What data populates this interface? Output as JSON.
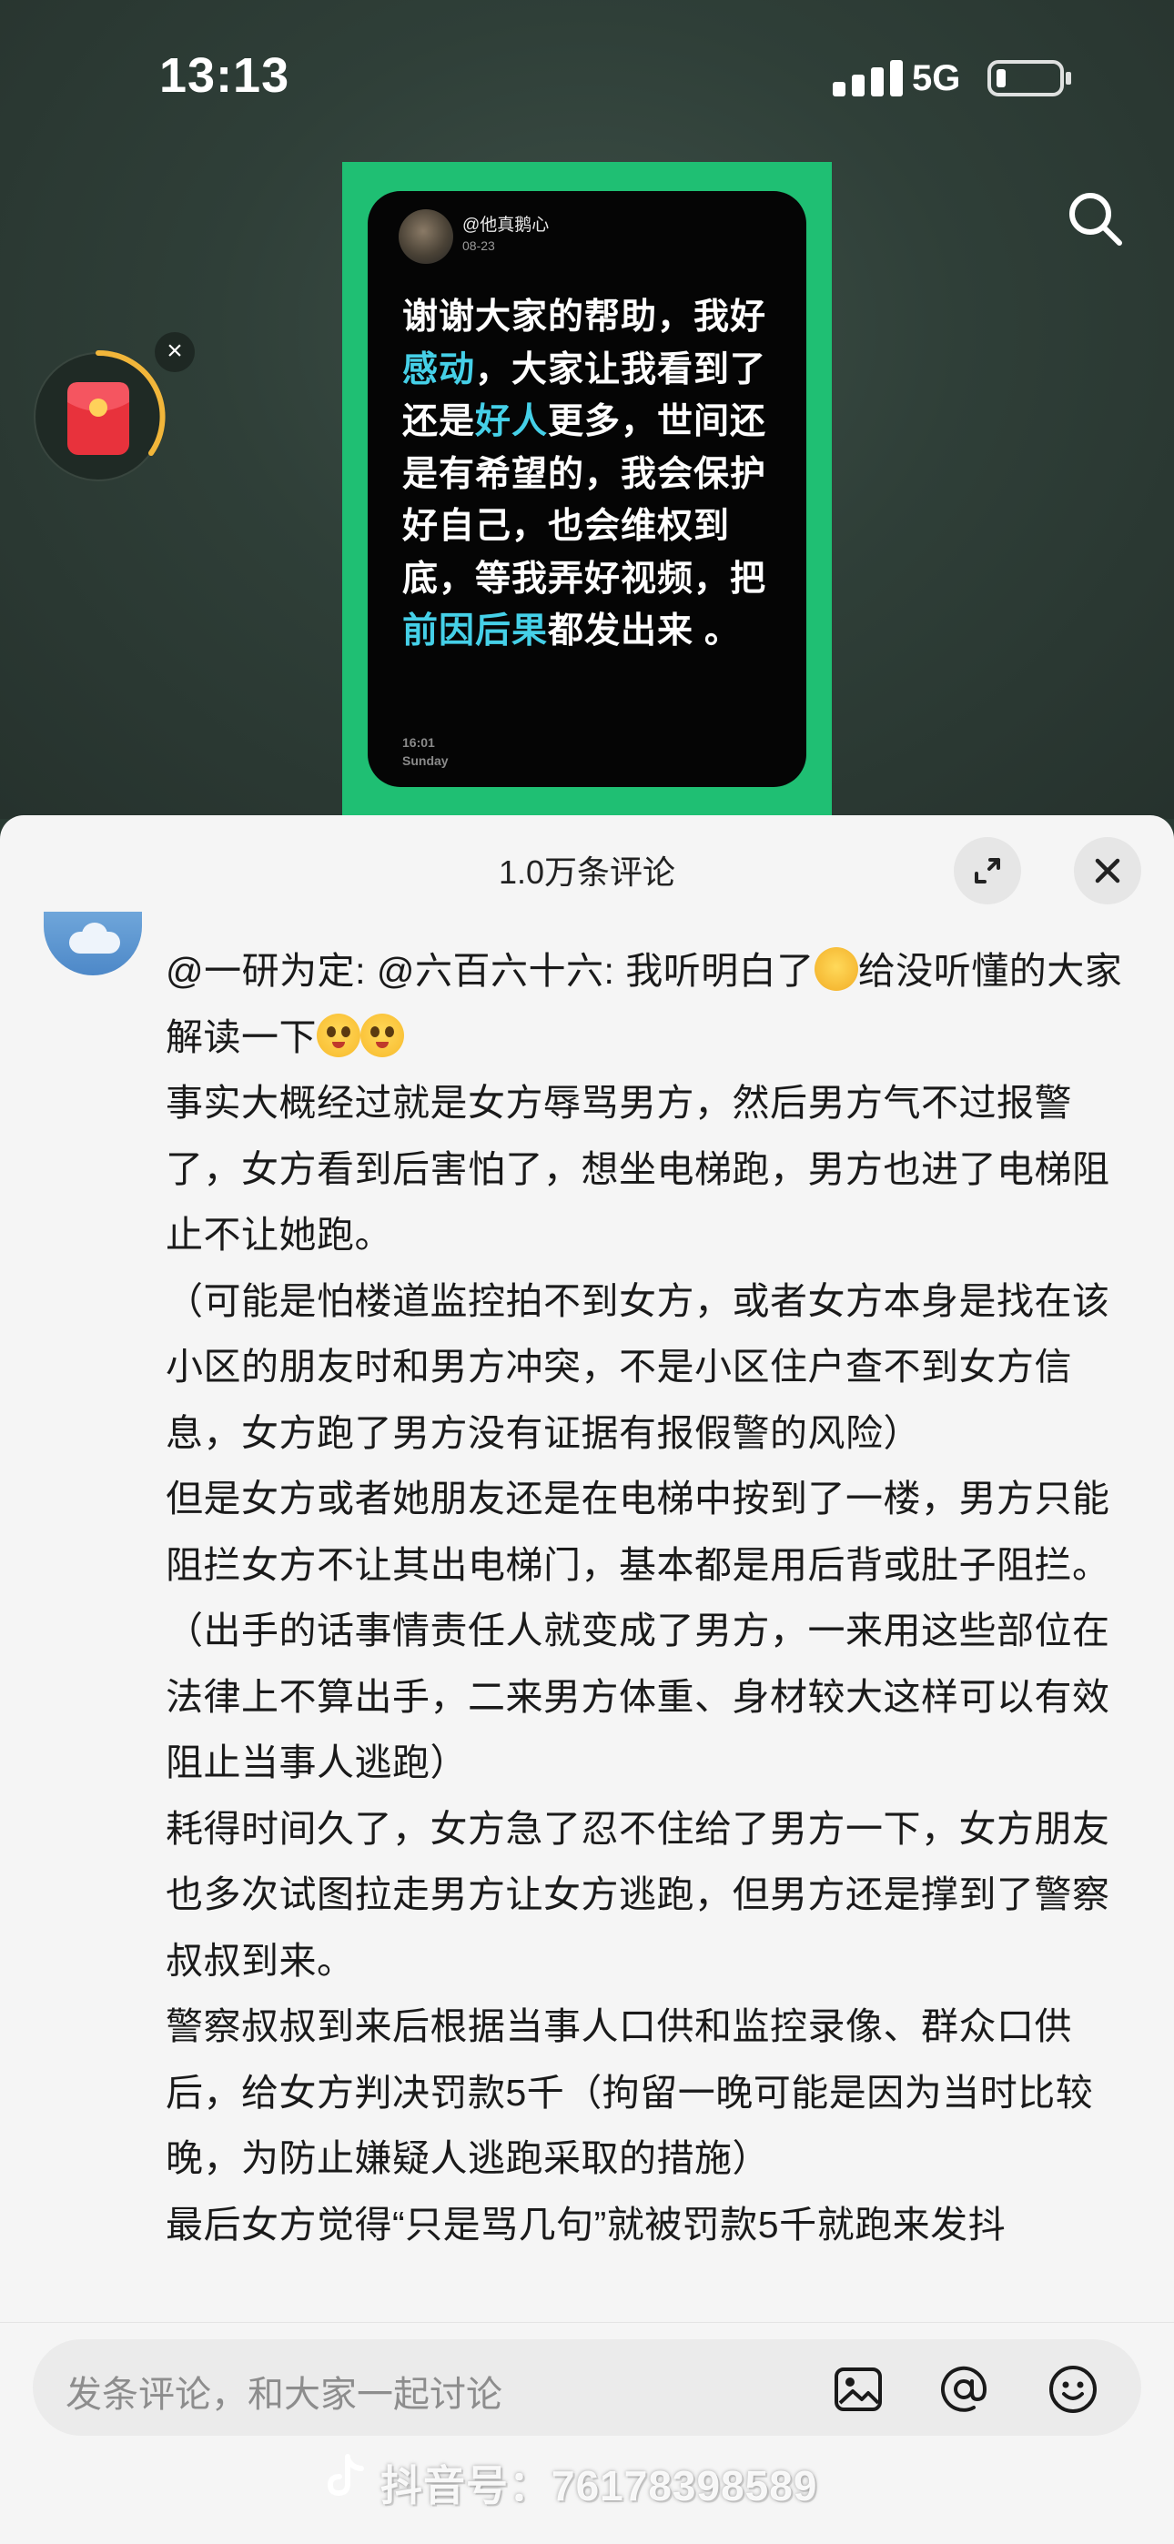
{
  "status_bar": {
    "time": "13:13",
    "network": "5G"
  },
  "post": {
    "username": "@他真鹅心",
    "date": "08-23",
    "text_parts": [
      {
        "t": "谢谢大家的帮助，我好",
        "hl": false
      },
      {
        "t": "感动",
        "hl": true
      },
      {
        "t": "，大家让我看到了还是",
        "hl": false
      },
      {
        "t": "好人",
        "hl": true
      },
      {
        "t": "更多，世间还是有希望的，我会保护好自己，也会维权到底，等我弄好视频，把",
        "hl": false
      },
      {
        "t": "前因后果",
        "hl": true
      },
      {
        "t": "都发出来 。",
        "hl": false
      }
    ],
    "time": "16:01",
    "weekday": "Sunday",
    "highlight_color": "#45d0e8",
    "card_color": "#1fbf73"
  },
  "comments_sheet": {
    "title": "1.0万条评论",
    "expand_icon": "expand-icon",
    "close_icon": "close-icon"
  },
  "comment": {
    "line1_before_emoji": "@一研为定: @六百六十六: 我听明白了",
    "line1_after_emoji": "给没听懂的大家解读一下",
    "paragraphs": [
      "事实大概经过就是女方辱骂男方，然后男方气不过报警了，女方看到后害怕了，想坐电梯跑，男方也进了电梯阻止不让她跑。",
      "（可能是怕楼道监控拍不到女方，或者女方本身是找在该小区的朋友时和男方冲突，不是小区住户查不到女方信息，女方跑了男方没有证据有报假警的风险）",
      "但是女方或者她朋友还是在电梯中按到了一楼，男方只能阻拦女方不让其出电梯门，基本都是用后背或肚子阻拦。",
      "（出手的话事情责任人就变成了男方，一来用这些部位在法律上不算出手，二来男方体重、身材较大这样可以有效阻止当事人逃跑）",
      "耗得时间久了，女方急了忍不住给了男方一下，女方朋友也多次试图拉走男方让女方逃跑，但男方还是撑到了警察叔叔到来。",
      "警察叔叔到来后根据当事人口供和监控录像、群众口供后，给女方判决罚款5千（拘留一晚可能是因为当时比较晚，为防止嫌疑人逃跑采取的措施）",
      "最后女方觉得“只是骂几句”就被罚款5千就跑来发抖"
    ]
  },
  "input": {
    "placeholder": "发条评论，和大家一起讨论",
    "icons": [
      "image-icon",
      "at-icon",
      "emoji-icon"
    ]
  },
  "watermark": {
    "text": "抖音号：76178398589"
  }
}
